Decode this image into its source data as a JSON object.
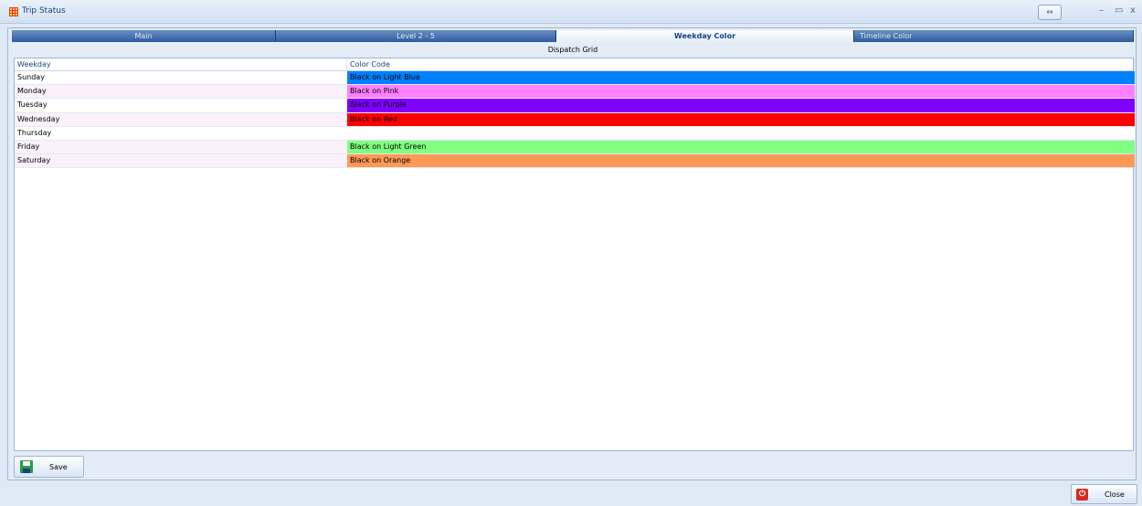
{
  "window": {
    "title": "Trip Status",
    "minimize": "–",
    "maximize": "▭",
    "close": "x",
    "extra_icon": "⇔"
  },
  "tabs": [
    {
      "label": "Main",
      "active": false
    },
    {
      "label": "Level 2 - 5",
      "active": false
    },
    {
      "label": "Weekday Color",
      "active": true
    },
    {
      "label": "Timeline Color",
      "active": false
    }
  ],
  "grid": {
    "caption": "Dispatch Grid",
    "columns": [
      "Weekday",
      "Color Code"
    ],
    "rows": [
      {
        "weekday": "Sunday",
        "color_code": "Black on Light Blue",
        "color": "#0080ff"
      },
      {
        "weekday": "Monday",
        "color_code": "Black on Pink",
        "color": "#ff80ff"
      },
      {
        "weekday": "Tuesday",
        "color_code": "Black on Purple",
        "color": "#8000ff"
      },
      {
        "weekday": "Wednesday",
        "color_code": "Black on Red",
        "color": "#ff0000"
      },
      {
        "weekday": "Thursday",
        "color_code": "",
        "color": "#ffffff"
      },
      {
        "weekday": "Friday",
        "color_code": "Black on Light Green",
        "color": "#80ff80"
      },
      {
        "weekday": "Saturday",
        "color_code": "Black on Orange",
        "color": "#ff9955"
      }
    ]
  },
  "buttons": {
    "save": "Save",
    "close": "Close"
  }
}
